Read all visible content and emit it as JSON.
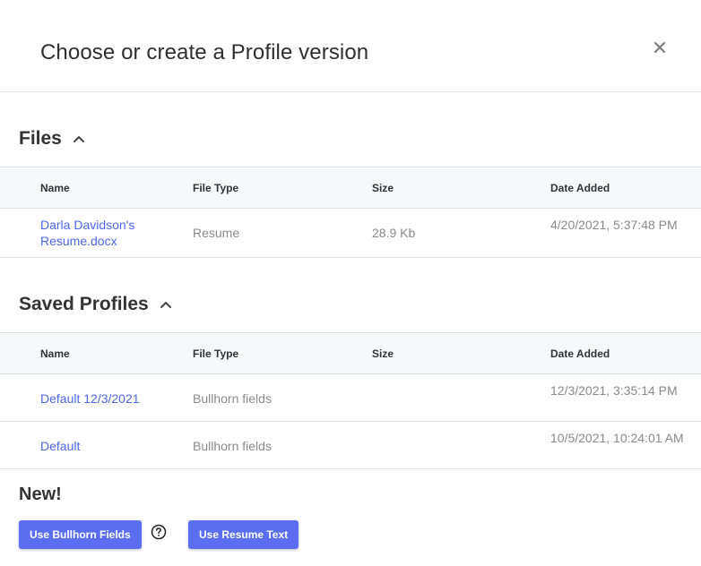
{
  "modal": {
    "title": "Choose or create a Profile version",
    "close_icon": "close-icon"
  },
  "files": {
    "title": "Files",
    "columns": [
      "Name",
      "File Type",
      "Size",
      "Date Added"
    ],
    "rows": [
      {
        "name": "Darla Davidson's Resume.docx",
        "type": "Resume",
        "size": "28.9 Kb",
        "date": "4/20/2021, 5:37:48 PM"
      }
    ]
  },
  "saved_profiles": {
    "title": "Saved Profiles",
    "columns": [
      "Name",
      "File Type",
      "Size",
      "Date Added"
    ],
    "rows": [
      {
        "name": "Default 12/3/2021",
        "type": "Bullhorn fields",
        "size": "",
        "date": "12/3/2021, 3:35:14 PM"
      },
      {
        "name": "Default",
        "type": "Bullhorn fields",
        "size": "",
        "date": "10/5/2021, 10:24:01 AM"
      }
    ]
  },
  "new_section": {
    "title": "New!",
    "use_bullhorn_label": "Use Bullhorn Fields",
    "use_resume_label": "Use Resume Text",
    "help_icon": "help-circle-icon"
  },
  "colors": {
    "accent": "#5b6df0",
    "link": "#4d67e8",
    "header_bg": "#f7f8fa",
    "muted_text": "#8a8a8a"
  }
}
